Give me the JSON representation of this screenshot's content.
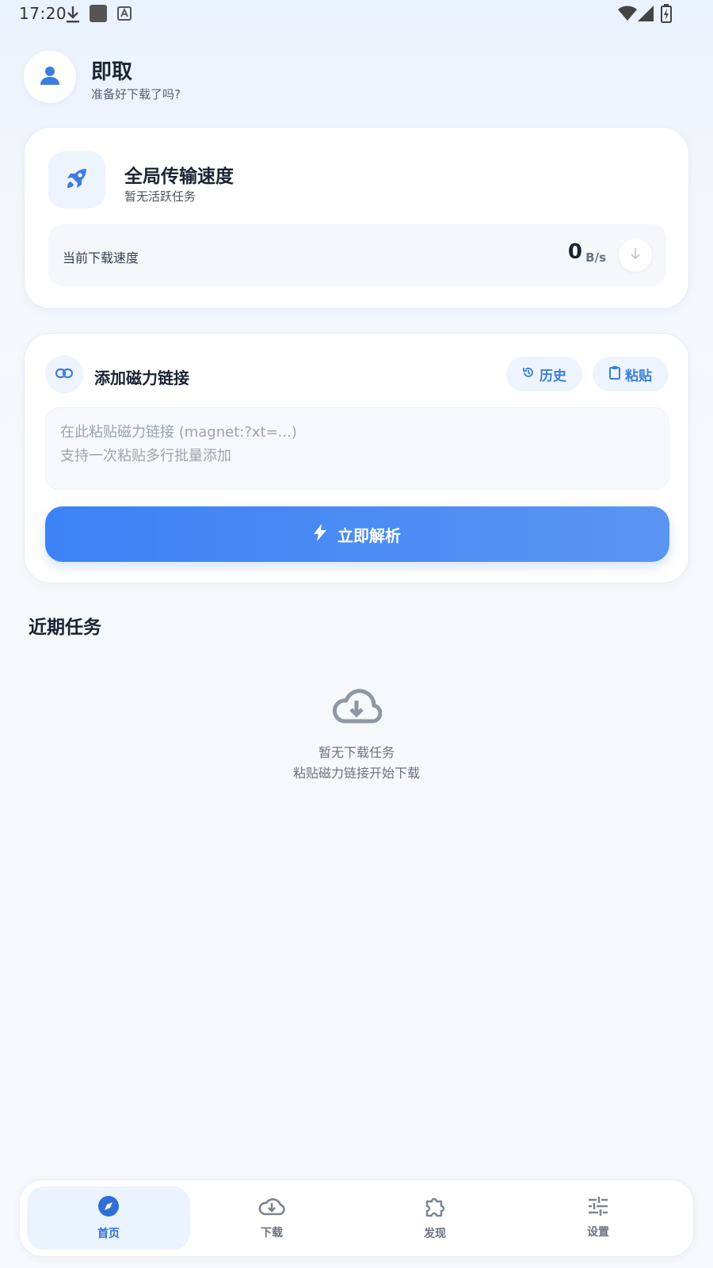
{
  "status_bar": {
    "time": "17:20",
    "icons": [
      "download-icon",
      "app-square-icon",
      "keyboard-a-icon",
      "wifi-icon",
      "signal-icon",
      "battery-icon"
    ]
  },
  "header": {
    "title": "即取",
    "subtitle": "准备好下载了吗?",
    "avatar_icon": "user-icon"
  },
  "speed_card": {
    "icon": "rocket-icon",
    "title": "全局传输速度",
    "subtitle": "暂无活跃任务",
    "current_label": "当前下载速度",
    "value": "0",
    "unit": "B/s",
    "indicator_icon": "arrow-down-icon"
  },
  "magnet_card": {
    "icon": "link-icon",
    "title": "添加磁力链接",
    "history_label": "历史",
    "paste_label": "粘贴",
    "input_placeholder": "在此粘贴磁力链接 (magnet:?xt=...)\n支持一次粘贴多行批量添加",
    "input_value": "",
    "parse_label": "立即解析"
  },
  "recent": {
    "title": "近期任务",
    "empty_icon": "cloud-download-icon",
    "empty_title": "暂无下载任务",
    "empty_hint": "粘贴磁力链接开始下载"
  },
  "bottom_nav": {
    "items": [
      {
        "label": "首页",
        "icon": "compass-icon",
        "active": true
      },
      {
        "label": "下载",
        "icon": "cloud-download-icon",
        "active": false
      },
      {
        "label": "发现",
        "icon": "puzzle-icon",
        "active": false
      },
      {
        "label": "设置",
        "icon": "sliders-icon",
        "active": false
      }
    ]
  },
  "colors": {
    "accent": "#3b82f6",
    "accent_soft": "#eef4fd",
    "text_primary": "#1b2433",
    "text_muted": "#6b7280",
    "background": "#f6f8fb"
  }
}
